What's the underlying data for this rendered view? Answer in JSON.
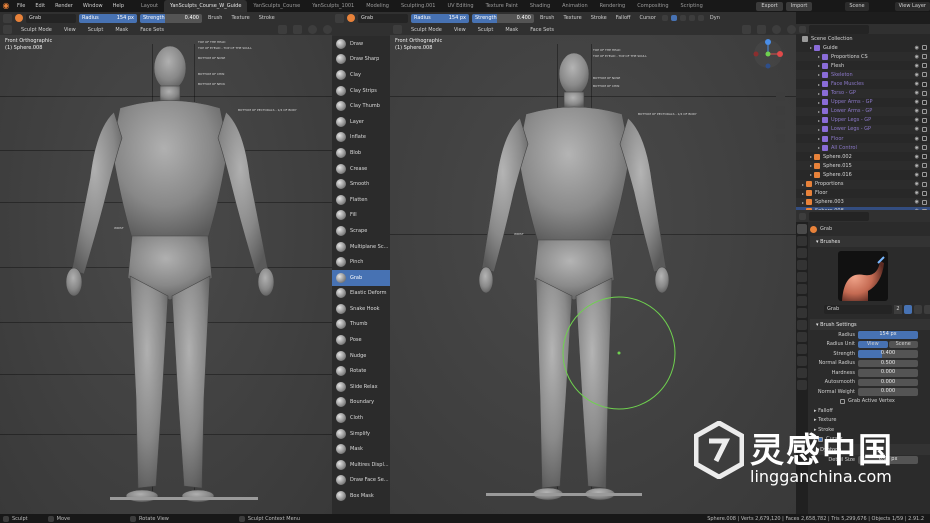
{
  "topbar": {
    "menu": [
      "File",
      "Edit",
      "Render",
      "Window",
      "Help"
    ],
    "tabs": [
      "Layout",
      "YanSculpts_Course_W_Guide",
      "YanSculpts_Course",
      "YanSculpts_1001",
      "Modeling",
      "Sculpting.001",
      "UV Editing",
      "Texture Paint",
      "Shading",
      "Animation",
      "Rendering",
      "Compositing",
      "Scripting"
    ],
    "active_tab": "YanSculpts_Course_W_Guide",
    "export_label": "Export",
    "import_label": "Import",
    "scene": "Scene",
    "view_layer": "View Layer"
  },
  "tool_header_left": {
    "brush": "Grab",
    "radius_label": "Radius",
    "radius_value": "154 px",
    "strength_label": "Strength",
    "strength_value": "0.400",
    "brush_menu": "Brush",
    "texture_menu": "Texture",
    "stroke_menu": "Stroke"
  },
  "tool_header_right": {
    "brush": "Grab",
    "radius_label": "Radius",
    "radius_value": "154 px",
    "strength_label": "Strength",
    "strength_value": "0.400",
    "brush_menu": "Brush",
    "texture_menu": "Texture",
    "stroke_menu": "Stroke",
    "falloff_menu": "Falloff",
    "cursor_menu": "Cursor",
    "dyn_label": "Dyn"
  },
  "viewport_left": {
    "mode": "Sculpt Mode",
    "menus": [
      "View",
      "Sculpt",
      "Mask",
      "Face Sets"
    ],
    "title": "Front Orthographic",
    "object": "(1) Sphere.008"
  },
  "viewport_right": {
    "mode": "Sculpt Mode",
    "menus": [
      "View",
      "Sculpt",
      "Mask",
      "Face Sets"
    ],
    "title": "Front Orthographic",
    "object": "(1) Sphere.008"
  },
  "brushes": [
    "Draw",
    "Draw Sharp",
    "Clay",
    "Clay Strips",
    "Clay Thumb",
    "Layer",
    "Inflate",
    "Blob",
    "Crease",
    "Smooth",
    "Flatten",
    "Fill",
    "Scrape",
    "Multiplane Sc...",
    "Pinch",
    "Grab",
    "Elastic Deform",
    "Snake Hook",
    "Thumb",
    "Pose",
    "Nudge",
    "Rotate",
    "Slide Relax",
    "Boundary",
    "Cloth",
    "Simplify",
    "Mask",
    "Multires Displ...",
    "Draw Face Se...",
    "Box Mask"
  ],
  "selected_brush": "Grab",
  "outliner": {
    "title": "Scene Collection",
    "rows": [
      {
        "name": "Guide",
        "indent": 1,
        "color": "#8a6cd8"
      },
      {
        "name": "Proportions CS",
        "indent": 2,
        "color": "#8a6cd8"
      },
      {
        "name": "Flesh",
        "indent": 2,
        "color": "#8a6cd8"
      },
      {
        "name": "Skeleton",
        "indent": 2,
        "color": "#8a6cd8"
      },
      {
        "name": "Face Muscles",
        "indent": 2,
        "color": "#8a6cd8"
      },
      {
        "name": "Torso - GP",
        "indent": 2,
        "color": "#8a6cd8"
      },
      {
        "name": "Upper Arms - GP",
        "indent": 2,
        "color": "#8a6cd8"
      },
      {
        "name": "Lower Arms - GP",
        "indent": 2,
        "color": "#8a6cd8"
      },
      {
        "name": "Upper Legs - GP",
        "indent": 2,
        "color": "#8a6cd8"
      },
      {
        "name": "Lower Legs - GP",
        "indent": 2,
        "color": "#8a6cd8"
      },
      {
        "name": "Floor",
        "indent": 2,
        "color": "#8a6cd8"
      },
      {
        "name": "All Control",
        "indent": 2,
        "color": "#8a6cd8"
      },
      {
        "name": "Sphere.002",
        "indent": 1,
        "color": "#e8823a"
      },
      {
        "name": "Sphere.015",
        "indent": 1,
        "color": "#e8823a"
      },
      {
        "name": "Sphere.016",
        "indent": 1,
        "color": "#e8823a"
      },
      {
        "name": "Proportions",
        "indent": 0,
        "color": "#e8823a"
      },
      {
        "name": "Floor",
        "indent": 0,
        "color": "#e8823a"
      },
      {
        "name": "Sphere.003",
        "indent": 0,
        "color": "#e8823a"
      },
      {
        "name": "Sphere.008",
        "indent": 0,
        "color": "#e8823a",
        "selected": true
      }
    ]
  },
  "properties": {
    "brush_name": "Grab",
    "brushes_section": "Brushes",
    "preview_brush": "Grab",
    "preview_users": "2",
    "settings_section": "Brush Settings",
    "fields": [
      {
        "label": "Radius",
        "value": "154 px"
      },
      {
        "label": "Radius Unit",
        "value": "View",
        "alt": "Scene"
      },
      {
        "label": "Strength",
        "value": "0.400"
      },
      {
        "label": "Normal Radius",
        "value": "0.500"
      },
      {
        "label": "Hardness",
        "value": "0.000"
      },
      {
        "label": "Autosmooth",
        "value": "0.000"
      },
      {
        "label": "Normal Weight",
        "value": "0.000"
      }
    ],
    "checkbox_label": "Grab Active Vertex",
    "falloff_section": "Falloff",
    "texture_section": "Texture",
    "stroke_section": "Stroke",
    "cursor_section": "Cursor",
    "dyntopo_section": "Dyntopo",
    "detail_size_label": "Detail Size",
    "detail_size_value": "6.00 px"
  },
  "statusbar": {
    "left_actions": [
      "Sculpt",
      "Move",
      "Rotate View",
      "Sculpt Context Menu"
    ],
    "stats": "Sphere.008 | Verts 2,679,120 | Faces 2,658,782 | Tris 5,299,676 | Objects 1/59 | 2.91.2"
  },
  "watermark": {
    "text": "灵感中国",
    "url": "lingganchina.com"
  },
  "colors": {
    "accent_blue": "#4772b3",
    "brand_orange": "#e8823a",
    "collection_purple": "#8a6cd8"
  }
}
